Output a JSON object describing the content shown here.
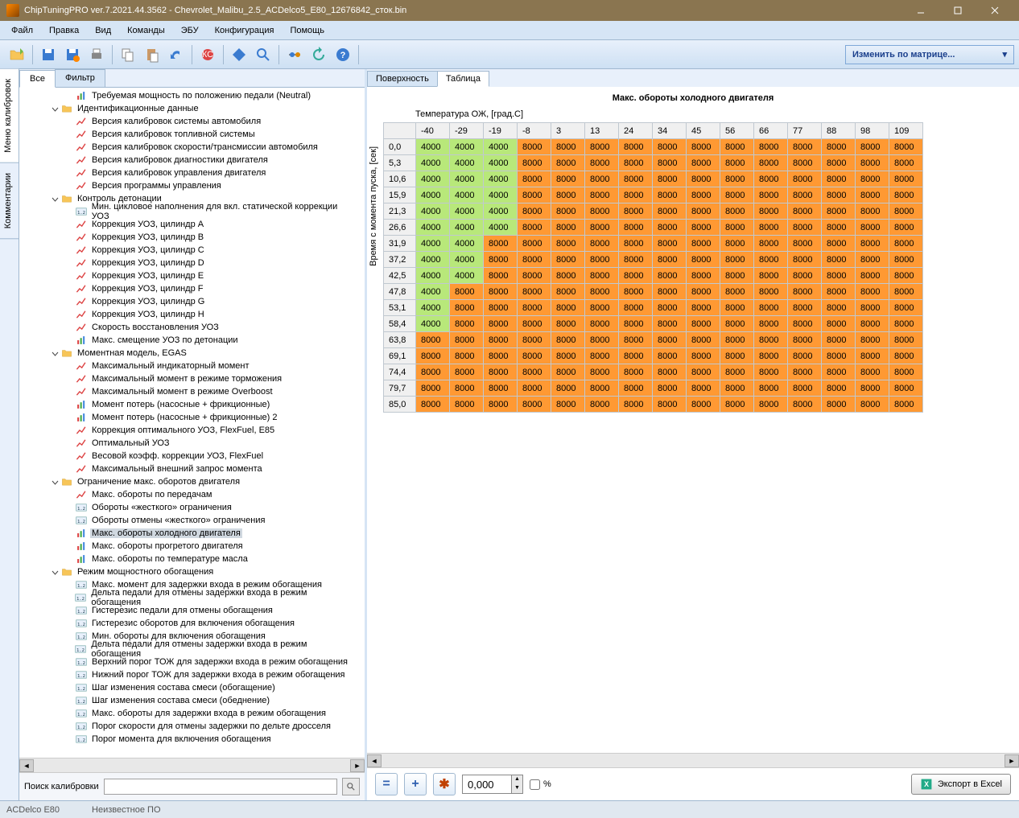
{
  "window": {
    "title": "ChipTuningPRO ver.7.2021.44.3562 - Chevrolet_Malibu_2.5_ACDelco5_E80_12676842_сток.bin"
  },
  "menubar": [
    "Файл",
    "Правка",
    "Вид",
    "Команды",
    "ЭБУ",
    "Конфигурация",
    "Помощь"
  ],
  "matrix_dropdown": "Изменить по матрице...",
  "side_tabs": {
    "active": "Меню калибровок",
    "other": "Комментарии"
  },
  "left_tabs": {
    "all": "Все",
    "filter": "Фильтр"
  },
  "search_label": "Поиск калибровки",
  "tree": [
    {
      "depth": 2,
      "type": "bars",
      "label": "Требуемая мощность по положению педали (Neutral)"
    },
    {
      "depth": 1,
      "type": "folder",
      "toggle": "-",
      "label": "Идентификационные данные"
    },
    {
      "depth": 2,
      "type": "chart",
      "label": "Версия калибровок системы автомобиля"
    },
    {
      "depth": 2,
      "type": "chart",
      "label": "Версия калибровок топливной системы"
    },
    {
      "depth": 2,
      "type": "chart",
      "label": "Версия калибровок скорости/трансмиссии автомобиля"
    },
    {
      "depth": 2,
      "type": "chart",
      "label": "Версия калибровок диагностики двигателя"
    },
    {
      "depth": 2,
      "type": "chart",
      "label": "Версия калибровок управления двигателя"
    },
    {
      "depth": 2,
      "type": "chart",
      "label": "Версия программы управления"
    },
    {
      "depth": 1,
      "type": "folder",
      "toggle": "-",
      "label": "Контроль детонации"
    },
    {
      "depth": 2,
      "type": "12",
      "label": "Мин. цикловое наполнения для вкл. статической коррекции УОЗ"
    },
    {
      "depth": 2,
      "type": "chart",
      "label": "Коррекция УОЗ, цилиндр A"
    },
    {
      "depth": 2,
      "type": "chart",
      "label": "Коррекция УОЗ, цилиндр B"
    },
    {
      "depth": 2,
      "type": "chart",
      "label": "Коррекция УОЗ, цилиндр C"
    },
    {
      "depth": 2,
      "type": "chart",
      "label": "Коррекция УОЗ, цилиндр D"
    },
    {
      "depth": 2,
      "type": "chart",
      "label": "Коррекция УОЗ, цилиндр E"
    },
    {
      "depth": 2,
      "type": "chart",
      "label": "Коррекция УОЗ, цилиндр F"
    },
    {
      "depth": 2,
      "type": "chart",
      "label": "Коррекция УОЗ, цилиндр G"
    },
    {
      "depth": 2,
      "type": "chart",
      "label": "Коррекция УОЗ, цилиндр H"
    },
    {
      "depth": 2,
      "type": "chart",
      "label": "Скорость восстановления УОЗ"
    },
    {
      "depth": 2,
      "type": "bars",
      "label": "Макс. смещение УОЗ по детонации"
    },
    {
      "depth": 1,
      "type": "folder",
      "toggle": "-",
      "label": "Моментная модель, EGAS"
    },
    {
      "depth": 2,
      "type": "chart",
      "label": "Максимальный индикаторный момент"
    },
    {
      "depth": 2,
      "type": "chart",
      "label": "Максимальный момент в режиме торможения"
    },
    {
      "depth": 2,
      "type": "chart",
      "label": "Максимальный момент в режиме Overboost"
    },
    {
      "depth": 2,
      "type": "bars",
      "label": "Момент потерь (насосные + фрикционные)"
    },
    {
      "depth": 2,
      "type": "bars",
      "label": "Момент потерь (насосные + фрикционные) 2"
    },
    {
      "depth": 2,
      "type": "chart",
      "label": "Коррекция оптимального УОЗ, FlexFuel, E85"
    },
    {
      "depth": 2,
      "type": "chart",
      "label": "Оптимальный УОЗ"
    },
    {
      "depth": 2,
      "type": "chart",
      "label": "Весовой коэфф. коррекции УОЗ, FlexFuel"
    },
    {
      "depth": 2,
      "type": "chart",
      "label": "Максимальный внешний запрос момента"
    },
    {
      "depth": 1,
      "type": "folder",
      "toggle": "-",
      "label": "Ограничение макс. оборотов двигателя"
    },
    {
      "depth": 2,
      "type": "chart",
      "label": "Макс. обороты по передачам"
    },
    {
      "depth": 2,
      "type": "12",
      "label": "Обороты «жесткого» ограничения"
    },
    {
      "depth": 2,
      "type": "12",
      "label": "Обороты отмены «жесткого» ограничения"
    },
    {
      "depth": 2,
      "type": "bars",
      "label": "Макс. обороты холодного двигателя",
      "selected": true
    },
    {
      "depth": 2,
      "type": "bars",
      "label": "Макс. обороты прогретого двигателя"
    },
    {
      "depth": 2,
      "type": "bars",
      "label": "Макс. обороты по температуре масла"
    },
    {
      "depth": 1,
      "type": "folder",
      "toggle": "-",
      "label": "Режим мощностного обогащения"
    },
    {
      "depth": 2,
      "type": "12",
      "label": "Макс. момент для задержки входа в режим обогащения"
    },
    {
      "depth": 2,
      "type": "12",
      "label": "Дельта педали для отмены задержки входа в режим обогащения"
    },
    {
      "depth": 2,
      "type": "12",
      "label": "Гистерезис педали для отмены обогащения"
    },
    {
      "depth": 2,
      "type": "12",
      "label": "Гистерезис оборотов для включения обогащения"
    },
    {
      "depth": 2,
      "type": "12",
      "label": "Мин. обороты для включения обогащения"
    },
    {
      "depth": 2,
      "type": "12",
      "label": "Дельта педали для отмены задержки входа в режим обогащения"
    },
    {
      "depth": 2,
      "type": "12",
      "label": "Верхний порог ТОЖ для задержки входа в режим обогащения"
    },
    {
      "depth": 2,
      "type": "12",
      "label": "Нижний порог ТОЖ для задержки входа в режим обогащения"
    },
    {
      "depth": 2,
      "type": "12",
      "label": "Шаг изменения состава смеси (обогащение)"
    },
    {
      "depth": 2,
      "type": "12",
      "label": "Шаг изменения состава смеси (обеднение)"
    },
    {
      "depth": 2,
      "type": "12",
      "label": "Макс. обороты для задержки входа в режим обогащения"
    },
    {
      "depth": 2,
      "type": "12",
      "label": "Порог скорости для отмены задержки по дельте дросселя"
    },
    {
      "depth": 2,
      "type": "12",
      "label": "Порог момента для включения обогащения"
    }
  ],
  "right_tabs": {
    "surface": "Поверхность",
    "table": "Таблица"
  },
  "chart_data": {
    "type": "table",
    "title": "Макс. обороты холодного двигателя",
    "xlabel": "Температура ОЖ, [град.C]",
    "ylabel": "Время с момента пуска, [сек]",
    "x": [
      "-40",
      "-29",
      "-19",
      "-8",
      "3",
      "13",
      "24",
      "34",
      "45",
      "56",
      "66",
      "77",
      "88",
      "98",
      "109"
    ],
    "y": [
      "0,0",
      "5,3",
      "10,6",
      "15,9",
      "21,3",
      "26,6",
      "31,9",
      "37,2",
      "42,5",
      "47,8",
      "53,1",
      "58,4",
      "63,8",
      "69,1",
      "74,4",
      "79,7",
      "85,0"
    ],
    "values": [
      [
        4000,
        4000,
        4000,
        8000,
        8000,
        8000,
        8000,
        8000,
        8000,
        8000,
        8000,
        8000,
        8000,
        8000,
        8000
      ],
      [
        4000,
        4000,
        4000,
        8000,
        8000,
        8000,
        8000,
        8000,
        8000,
        8000,
        8000,
        8000,
        8000,
        8000,
        8000
      ],
      [
        4000,
        4000,
        4000,
        8000,
        8000,
        8000,
        8000,
        8000,
        8000,
        8000,
        8000,
        8000,
        8000,
        8000,
        8000
      ],
      [
        4000,
        4000,
        4000,
        8000,
        8000,
        8000,
        8000,
        8000,
        8000,
        8000,
        8000,
        8000,
        8000,
        8000,
        8000
      ],
      [
        4000,
        4000,
        4000,
        8000,
        8000,
        8000,
        8000,
        8000,
        8000,
        8000,
        8000,
        8000,
        8000,
        8000,
        8000
      ],
      [
        4000,
        4000,
        4000,
        8000,
        8000,
        8000,
        8000,
        8000,
        8000,
        8000,
        8000,
        8000,
        8000,
        8000,
        8000
      ],
      [
        4000,
        4000,
        8000,
        8000,
        8000,
        8000,
        8000,
        8000,
        8000,
        8000,
        8000,
        8000,
        8000,
        8000,
        8000
      ],
      [
        4000,
        4000,
        8000,
        8000,
        8000,
        8000,
        8000,
        8000,
        8000,
        8000,
        8000,
        8000,
        8000,
        8000,
        8000
      ],
      [
        4000,
        4000,
        8000,
        8000,
        8000,
        8000,
        8000,
        8000,
        8000,
        8000,
        8000,
        8000,
        8000,
        8000,
        8000
      ],
      [
        4000,
        8000,
        8000,
        8000,
        8000,
        8000,
        8000,
        8000,
        8000,
        8000,
        8000,
        8000,
        8000,
        8000,
        8000
      ],
      [
        4000,
        8000,
        8000,
        8000,
        8000,
        8000,
        8000,
        8000,
        8000,
        8000,
        8000,
        8000,
        8000,
        8000,
        8000
      ],
      [
        4000,
        8000,
        8000,
        8000,
        8000,
        8000,
        8000,
        8000,
        8000,
        8000,
        8000,
        8000,
        8000,
        8000,
        8000
      ],
      [
        8000,
        8000,
        8000,
        8000,
        8000,
        8000,
        8000,
        8000,
        8000,
        8000,
        8000,
        8000,
        8000,
        8000,
        8000
      ],
      [
        8000,
        8000,
        8000,
        8000,
        8000,
        8000,
        8000,
        8000,
        8000,
        8000,
        8000,
        8000,
        8000,
        8000,
        8000
      ],
      [
        8000,
        8000,
        8000,
        8000,
        8000,
        8000,
        8000,
        8000,
        8000,
        8000,
        8000,
        8000,
        8000,
        8000,
        8000
      ],
      [
        8000,
        8000,
        8000,
        8000,
        8000,
        8000,
        8000,
        8000,
        8000,
        8000,
        8000,
        8000,
        8000,
        8000,
        8000
      ],
      [
        8000,
        8000,
        8000,
        8000,
        8000,
        8000,
        8000,
        8000,
        8000,
        8000,
        8000,
        8000,
        8000,
        8000,
        8000
      ]
    ]
  },
  "controls": {
    "num_value": "0,000",
    "percent_label": "%",
    "export_label": "Экспорт в Excel"
  },
  "statusbar": {
    "ecu": "ACDelco E80",
    "fw": "Неизвестное ПО"
  }
}
